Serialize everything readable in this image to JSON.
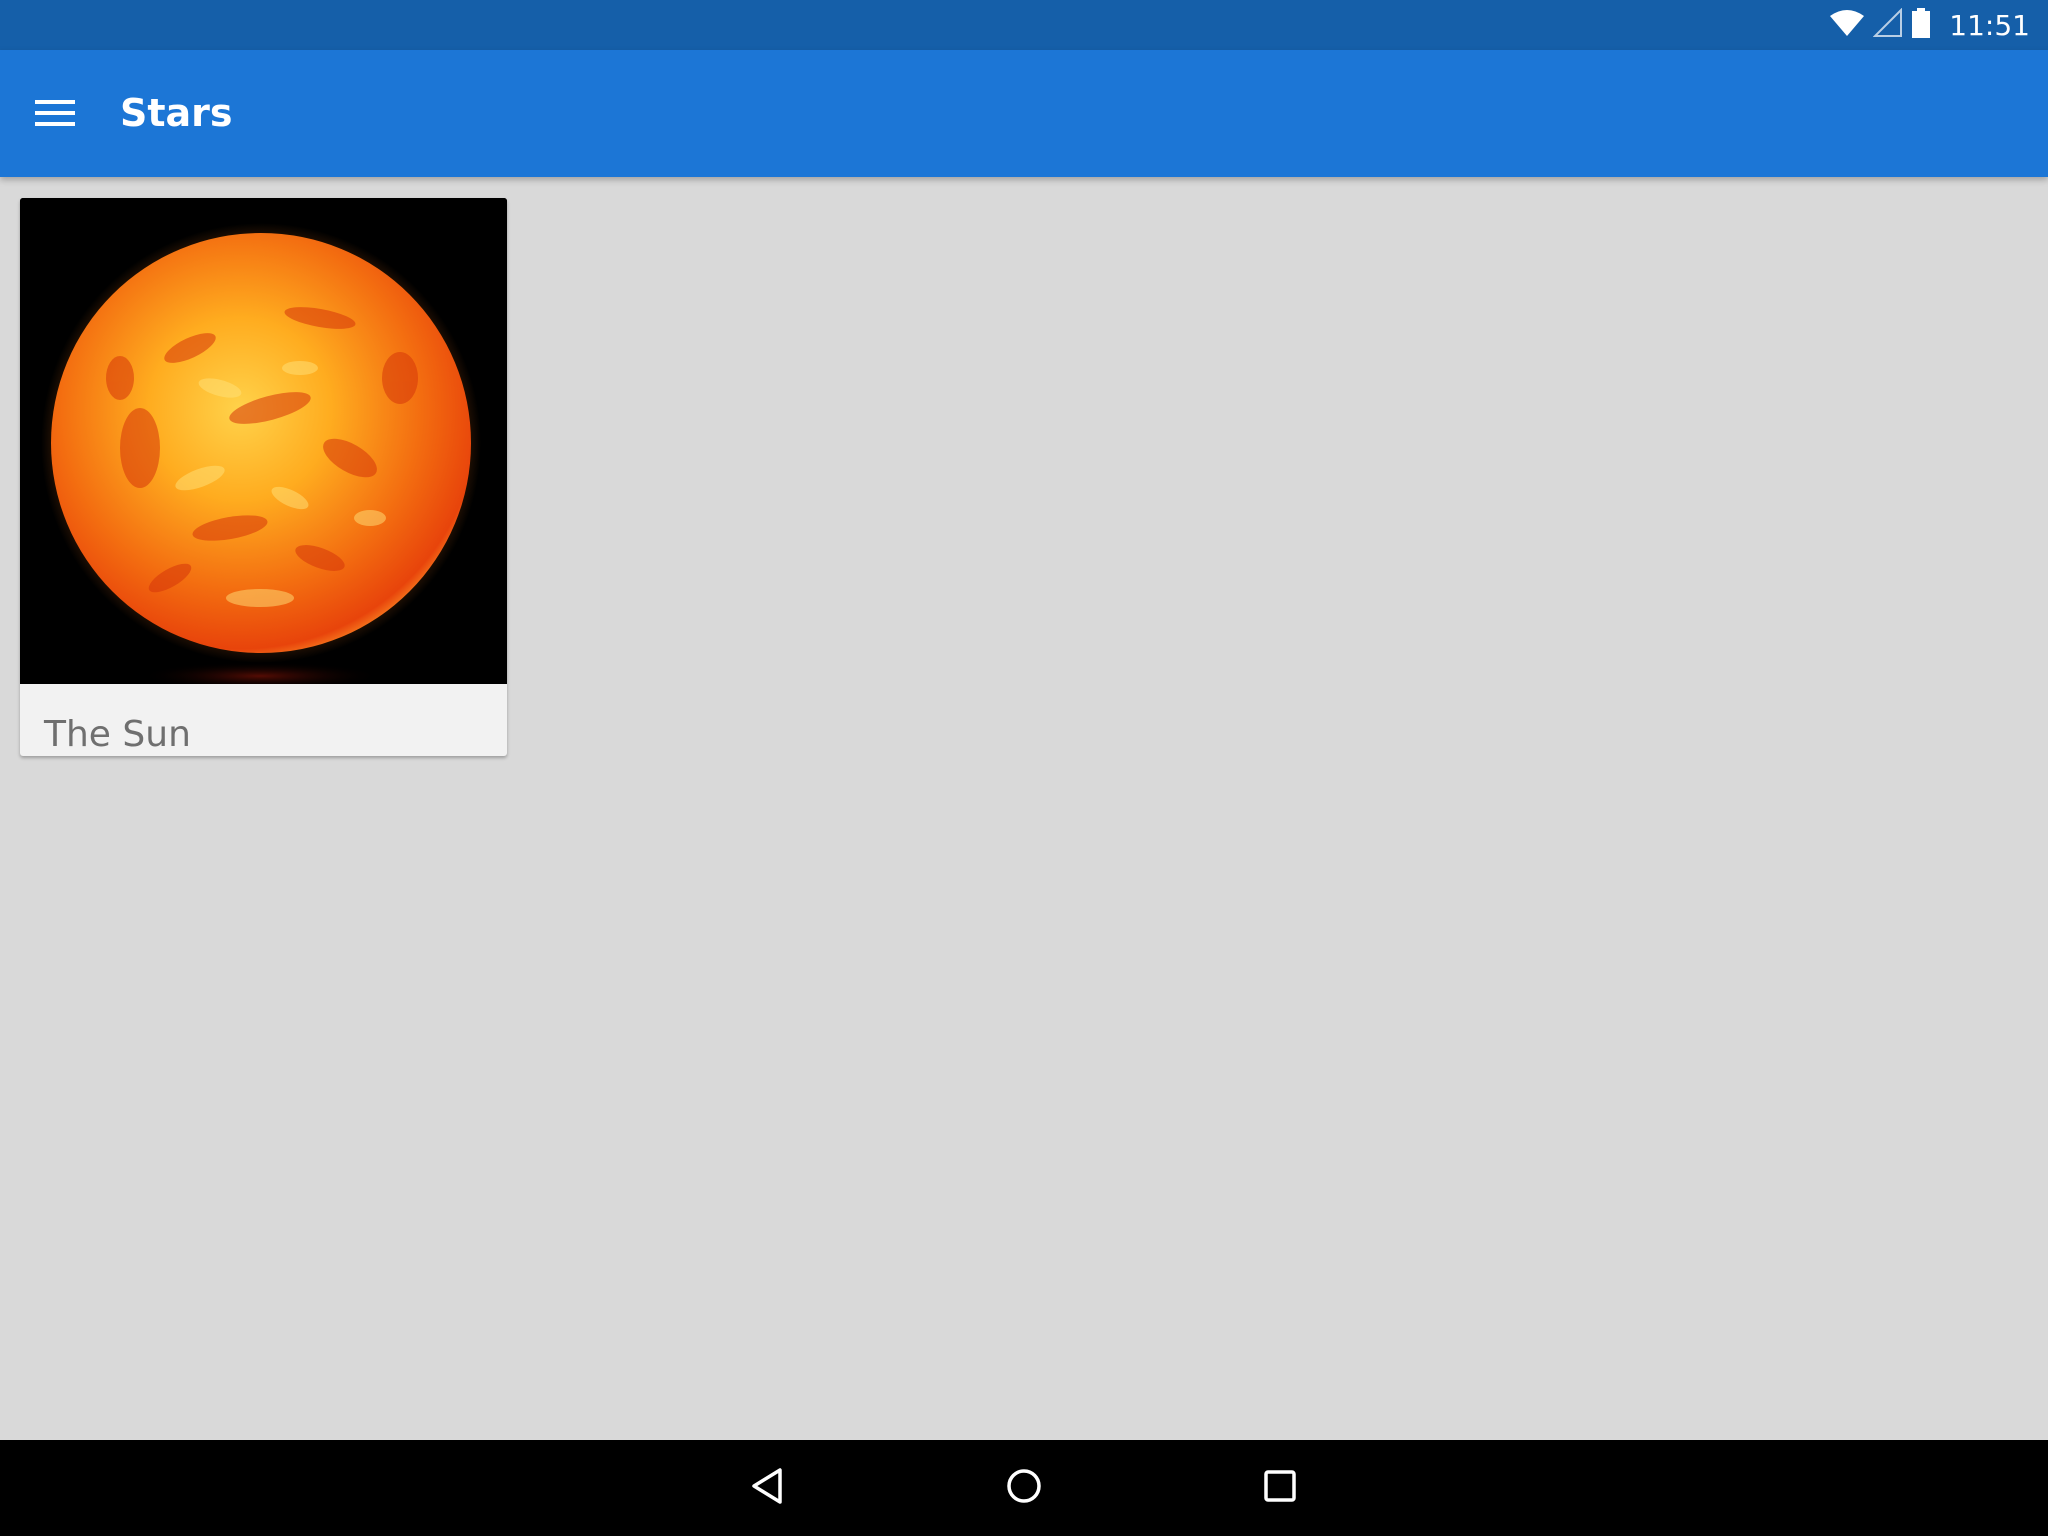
{
  "status_bar": {
    "time": "11:51",
    "icons": [
      "wifi-icon",
      "cellular-signal-icon",
      "battery-icon"
    ]
  },
  "app_bar": {
    "title": "Stars",
    "menu_icon": "hamburger-menu-icon",
    "color": "#1c76d6"
  },
  "cards": [
    {
      "label": "The Sun",
      "image": "sun-image"
    }
  ],
  "nav_bar": {
    "buttons": [
      "back-icon",
      "home-icon",
      "recents-icon"
    ]
  }
}
